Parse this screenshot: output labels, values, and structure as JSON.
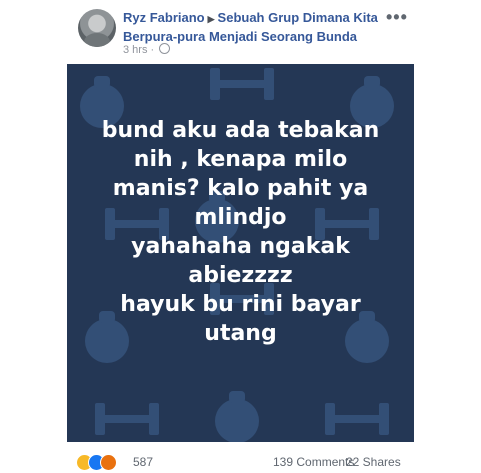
{
  "post": {
    "author": "Ryz Fabriano",
    "group": "Sebuah Grup Dimana Kita Berpura-pura Menjadi Seorang Bunda",
    "time": "3 hrs",
    "text_lines": [
      "bund aku ada tebakan",
      "nih , kenapa milo",
      "manis? kalo pahit ya",
      "mlindjo",
      "yahahaha ngakak",
      "abiezzzz",
      "hayuk bu rini bayar",
      "utang"
    ],
    "background_color": "#243755"
  },
  "footer": {
    "reaction_count": "587",
    "comments": "139 Comments",
    "shares": "22 Shares",
    "reaction_icons": [
      "haha-icon",
      "like-icon",
      "angry-icon"
    ]
  },
  "icons": {
    "more": "more-options-icon",
    "audience": "globe-icon"
  }
}
